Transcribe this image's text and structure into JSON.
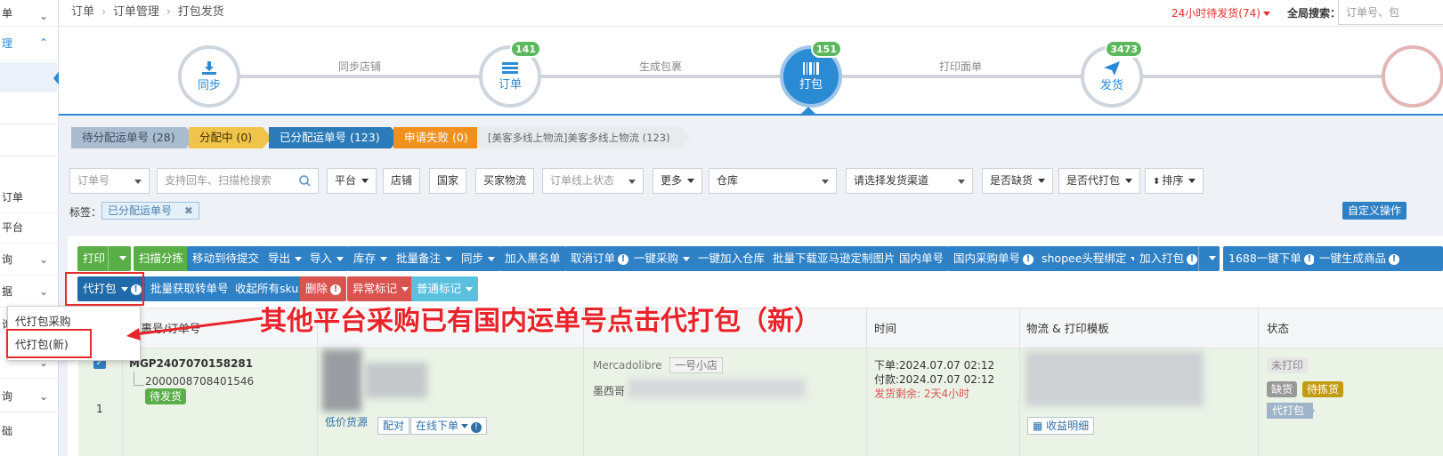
{
  "sidebar": {
    "items": [
      {
        "label": "单",
        "expanded": false
      },
      {
        "label": "理",
        "expanded": true
      },
      {
        "label": ""
      },
      {
        "label": ""
      },
      {
        "label": ""
      },
      {
        "label": "订单"
      },
      {
        "label": "平台"
      },
      {
        "label": "询",
        "expanded": false
      },
      {
        "label": "据",
        "expanded": false
      },
      {
        "label": "询",
        "expanded": false
      },
      {
        "label": "",
        "expanded": false
      },
      {
        "label": "询",
        "expanded": false
      },
      {
        "label": "础"
      }
    ]
  },
  "topbar": {
    "breadcrumb": [
      "订单",
      "订单管理",
      "打包发货"
    ],
    "alert": "24小时待发货(74)",
    "global_search_label": "全局搜索：",
    "global_search_placeholder": "订单号、包"
  },
  "workflow": {
    "steps": [
      {
        "label": "同步",
        "badge": "",
        "icon": "download-icon"
      },
      {
        "label": "订单",
        "badge": "141",
        "icon": "list-icon"
      },
      {
        "label": "打包",
        "badge": "151",
        "icon": "barcode-icon",
        "active": true
      },
      {
        "label": "发货",
        "badge": "3473",
        "icon": "plane-icon"
      }
    ],
    "connectors": [
      "同步店铺",
      "生成包裹",
      "打印面单"
    ]
  },
  "status_tabs": [
    {
      "label": "待分配运单号 (28)",
      "color": "#a9bcd0"
    },
    {
      "label": "分配中 (0)",
      "color": "#f0c34a"
    },
    {
      "label": "已分配运单号 (123)",
      "color": "#2b7bb9"
    },
    {
      "label": "申请失败 (0)",
      "color": "#f0901e"
    },
    {
      "label": "[美客多线上物流]美客多线上物流 (123)",
      "color": "#e8eaec"
    }
  ],
  "filters": {
    "order_no": "订单号",
    "search_placeholder": "支持回车、扫描枪搜索",
    "platform": "平台",
    "shop": "店铺",
    "country": "国家",
    "buyer_logistics": "买家物流",
    "online_status": "订单线上状态",
    "more": "更多",
    "warehouse": "仓库",
    "channel": "请选择发货渠道",
    "out_of_stock": "是否缺货",
    "proxy_pack": "是否代打包",
    "sort": "排序",
    "tag_label": "标签：",
    "tag_value": "已分配运单号",
    "custom_action": "自定义操作"
  },
  "toolbar": {
    "row1": [
      "打印",
      "扫描分拣",
      "移动到待提交",
      "导出",
      "导入",
      "库存",
      "批量备注",
      "同步",
      "加入黑名单",
      "取消订单",
      "一键采购",
      "一键加入仓库",
      "批量下载亚马逊定制图片",
      "国内单号",
      "国内采购单号",
      "shopee头程绑定",
      "加入打包",
      "1688一键下单",
      "一键生成商品"
    ],
    "row2": [
      "代打包",
      "批量获取转单号",
      "收起所有sku",
      "删除",
      "异常标记",
      "普通标记"
    ]
  },
  "dropdown": {
    "items": [
      "代打包采购",
      "代打包(新)"
    ]
  },
  "annotation": "其他平台采购已有国内运单号点击代打包（新）",
  "table": {
    "headers": [
      "包裹号/订单号",
      "",
      "",
      "时间",
      "物流 & 打印模板",
      "状态"
    ],
    "row": {
      "package_no": "MGP2407070158281",
      "order_no": "2000008708401546",
      "status_tag": "待发货",
      "index": "1",
      "platform": "Mercadolibre",
      "shop": "一号小店",
      "country": "墨西哥",
      "order_time": "下单:2024.07.07 02:12",
      "pay_time": "付款:2024.07.07 02:12",
      "remain": "发货剩余: 2天4小时",
      "low_price": "低价货源",
      "match": "配对",
      "online_order": "在线下单",
      "profit": "收益明细",
      "print_status": "未打印",
      "tags": [
        "缺货",
        "待拣货"
      ],
      "proxy_tag": "代打包"
    }
  }
}
